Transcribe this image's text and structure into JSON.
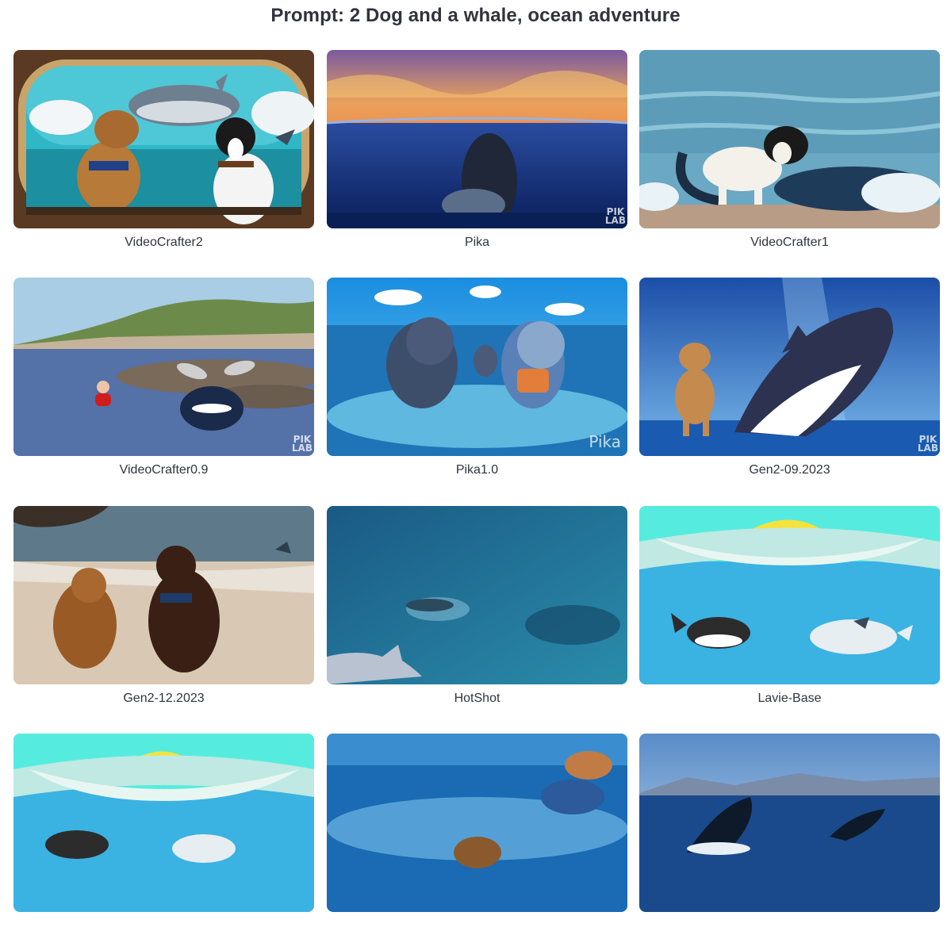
{
  "prompt_title": "Prompt: 2 Dog and a whale, ocean adventure",
  "videos": [
    {
      "label": "VideoCrafter2"
    },
    {
      "label": "Pika"
    },
    {
      "label": "VideoCrafter1"
    },
    {
      "label": "VideoCrafter0.9"
    },
    {
      "label": "Pika1.0"
    },
    {
      "label": "Gen2-09.2023"
    },
    {
      "label": "Gen2-12.2023"
    },
    {
      "label": "HotShot"
    },
    {
      "label": "Lavie-Base"
    },
    {
      "label": ""
    },
    {
      "label": ""
    },
    {
      "label": ""
    }
  ],
  "watermarks": {
    "pika_labs_line1": "PIK",
    "pika_labs_line2": "LAB",
    "pika": "Pika"
  }
}
